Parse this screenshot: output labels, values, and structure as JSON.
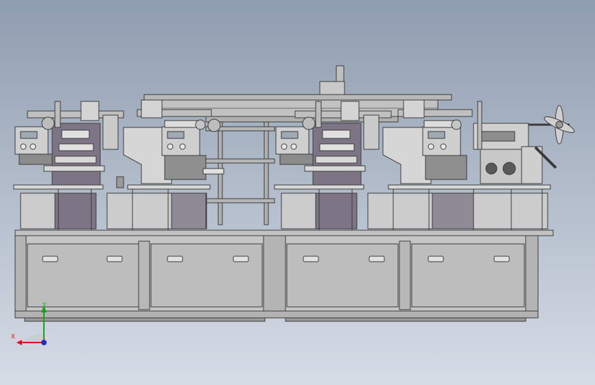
{
  "viewport": {
    "background_top": "#8f9db0",
    "background_bottom": "#d6dce6"
  },
  "model": {
    "frame_fill": "#c6c6c6",
    "frame_dark": "#9d9d9d",
    "line_color": "#3a3a3a",
    "drawer_fill": "#bdbdbd",
    "purple_shade": "#7d7486",
    "panel_fill": "#d2d2d2"
  },
  "triad": {
    "x_label": "X",
    "y_label": "Y",
    "x_color": "#d01818",
    "y_color": "#18a018",
    "z_color": "#1830c8"
  }
}
